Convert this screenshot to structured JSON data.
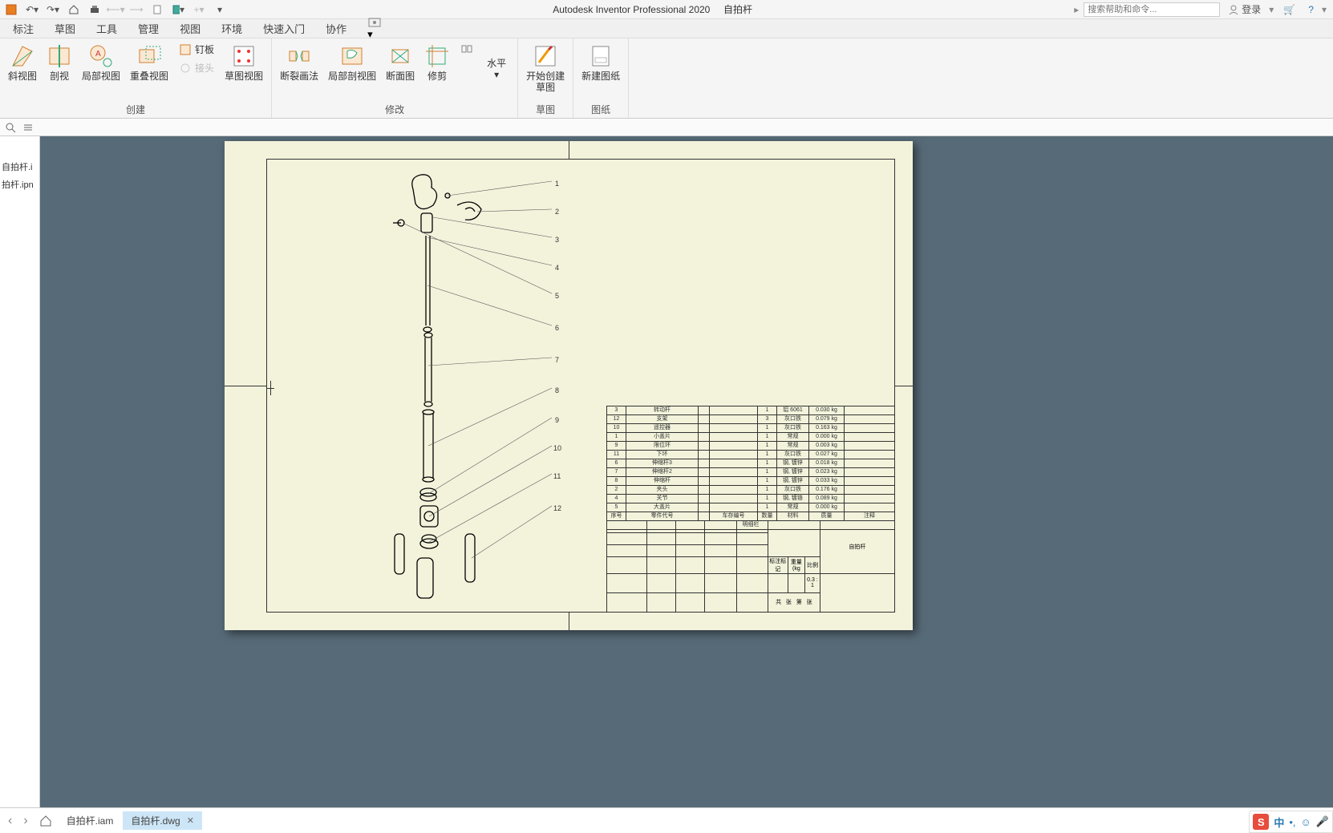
{
  "app": {
    "title": "Autodesk Inventor Professional 2020",
    "doc": "自拍杆",
    "search_placeholder": "搜索帮助和命令...",
    "login": "登录"
  },
  "ribbon_tabs": [
    "标注",
    "草图",
    "工具",
    "管理",
    "视图",
    "环境",
    "快速入门",
    "协作"
  ],
  "ribbon": {
    "groups": {
      "create": {
        "label": "创建",
        "buttons": {
          "slant": "斜视图",
          "section": "剖视",
          "detail": "局部视图",
          "overlay": "重叠视图",
          "nailboard": "钉板",
          "joint": "接头",
          "sketchview": "草图视图"
        }
      },
      "modify": {
        "label": "修改",
        "buttons": {
          "break": "断裂画法",
          "breakout": "局部剖视图",
          "slice": "断面图",
          "crop": "修剪",
          "horiz": "水平"
        }
      },
      "sketch": {
        "label": "草图",
        "buttons": {
          "start": "开始创建\n草图"
        }
      },
      "sheet": {
        "label": "图纸",
        "buttons": {
          "new": "新建图纸"
        }
      }
    }
  },
  "browser": {
    "items": [
      "自拍杆.i",
      "拍杆.ipn"
    ]
  },
  "callouts": [
    "1",
    "2",
    "3",
    "4",
    "5",
    "6",
    "7",
    "8",
    "9",
    "10",
    "11",
    "12"
  ],
  "parts_list": {
    "header": [
      "序号",
      "零件代号",
      "",
      "车存编号",
      "数量",
      "材料",
      "质量",
      "注释"
    ],
    "footnote": "明细栏",
    "rows": [
      [
        "3",
        "转动杆",
        "",
        "",
        "1",
        "铝 6061",
        "0.030 kg",
        ""
      ],
      [
        "12",
        "支架",
        "",
        "",
        "3",
        "灰口铁",
        "0.079 kg",
        ""
      ],
      [
        "10",
        "遥控器",
        "",
        "",
        "1",
        "灰口铁",
        "0.163 kg",
        ""
      ],
      [
        "1",
        "小盖片",
        "",
        "",
        "1",
        "常规",
        "0.000 kg",
        ""
      ],
      [
        "9",
        "限位环",
        "",
        "",
        "1",
        "常规",
        "0.003 kg",
        ""
      ],
      [
        "11",
        "下环",
        "",
        "",
        "1",
        "灰口铁",
        "0.027 kg",
        ""
      ],
      [
        "6",
        "伸缩杆3",
        "",
        "",
        "1",
        "钢, 镀锌",
        "0.018 kg",
        ""
      ],
      [
        "7",
        "伸缩杆2",
        "",
        "",
        "1",
        "钢, 镀锌",
        "0.023 kg",
        ""
      ],
      [
        "8",
        "伸缩杆",
        "",
        "",
        "1",
        "钢, 镀锌",
        "0.033 kg",
        ""
      ],
      [
        "2",
        "夹头",
        "",
        "",
        "1",
        "灰口铁",
        "0.176 kg",
        ""
      ],
      [
        "4",
        "关节",
        "",
        "",
        "1",
        "钢, 镀铬",
        "0.089 kg",
        ""
      ],
      [
        "5",
        "大盖片",
        "",
        "",
        "1",
        "常规",
        "0.000 kg",
        ""
      ]
    ]
  },
  "title_block": {
    "project": "自拍杆",
    "marks": "标注标记",
    "weight": "重量(kg",
    "scale": "比例",
    "scale_val": "0.3 : 1",
    "sig1": "共",
    "sig2": "张",
    "sig3": "第",
    "sig4": "张"
  },
  "doc_tabs": {
    "tab1": "自拍杆.iam",
    "tab2": "自拍杆.dwg"
  },
  "ime": {
    "cn": "中"
  }
}
